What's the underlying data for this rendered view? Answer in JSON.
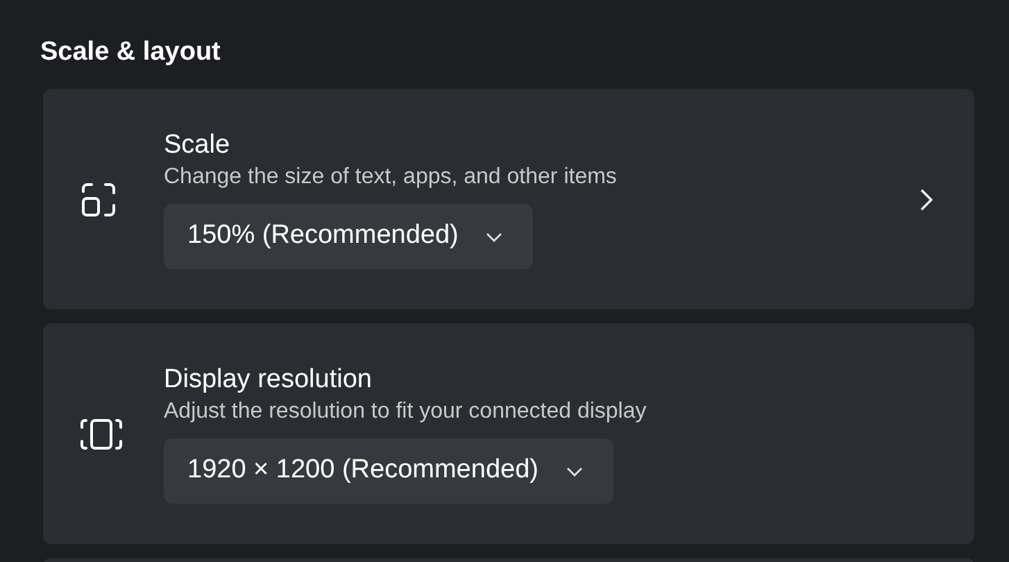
{
  "section_title": "Scale & layout",
  "cards": [
    {
      "kind": "scale",
      "title": "Scale",
      "description": "Change the size of text, apps, and other items",
      "dropdown": "150% (Recommended)",
      "has_chevron": true
    },
    {
      "kind": "resolution",
      "title": "Display resolution",
      "description": "Adjust the resolution to fit your connected display",
      "dropdown": "1920 × 1200 (Recommended)",
      "has_chevron": false
    }
  ]
}
